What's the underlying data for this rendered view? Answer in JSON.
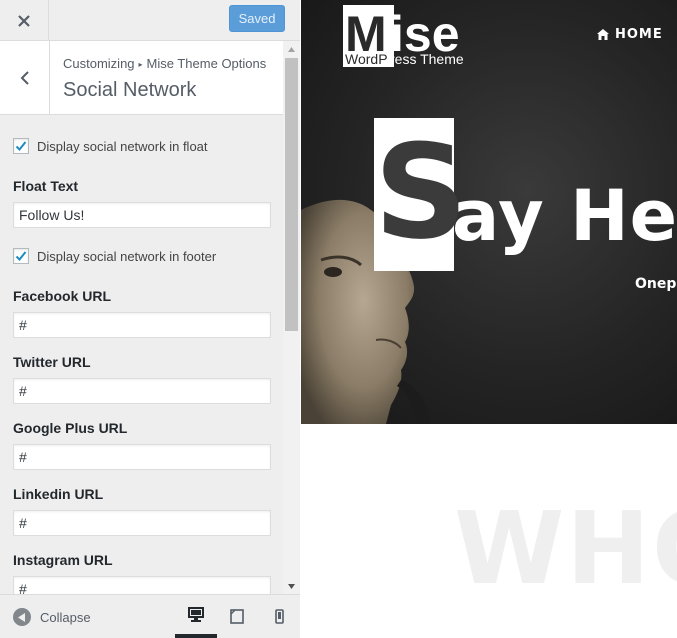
{
  "topbar": {
    "close_icon": "close-icon",
    "save_button_label": "Saved",
    "save_button_color": "#5b9dd9"
  },
  "section": {
    "breadcrumb_parent": "Customizing",
    "breadcrumb_separator_icon": "arrow-right-small-icon",
    "breadcrumb_panel": "Mise Theme Options",
    "title": "Social Network",
    "back_icon": "chevron-left-icon"
  },
  "controls": {
    "float_checkbox": {
      "label": "Display social network in float",
      "checked": true
    },
    "float_text": {
      "label": "Float Text",
      "value": "Follow Us!"
    },
    "footer_checkbox": {
      "label": "Display social network in footer",
      "checked": true
    },
    "facebook": {
      "label": "Facebook URL",
      "value": "#"
    },
    "twitter": {
      "label": "Twitter URL",
      "value": "#"
    },
    "google_plus": {
      "label": "Google Plus URL",
      "value": "#"
    },
    "linkedin": {
      "label": "Linkedin URL",
      "value": "#"
    },
    "instagram": {
      "label": "Instagram URL",
      "value": "#"
    }
  },
  "footer": {
    "collapse_label": "Collapse",
    "devices": [
      "desktop",
      "tablet",
      "mobile"
    ],
    "active_device": "desktop"
  },
  "preview": {
    "logo_title": "Mise",
    "logo_subtitle": "WordPress Theme",
    "nav_home": "HOME",
    "nav_home_icon": "home-icon",
    "hero_first_letter": "S",
    "hero_rest": "ay Hell",
    "hero_sub": "Onepa",
    "section_heading": "WHO"
  }
}
